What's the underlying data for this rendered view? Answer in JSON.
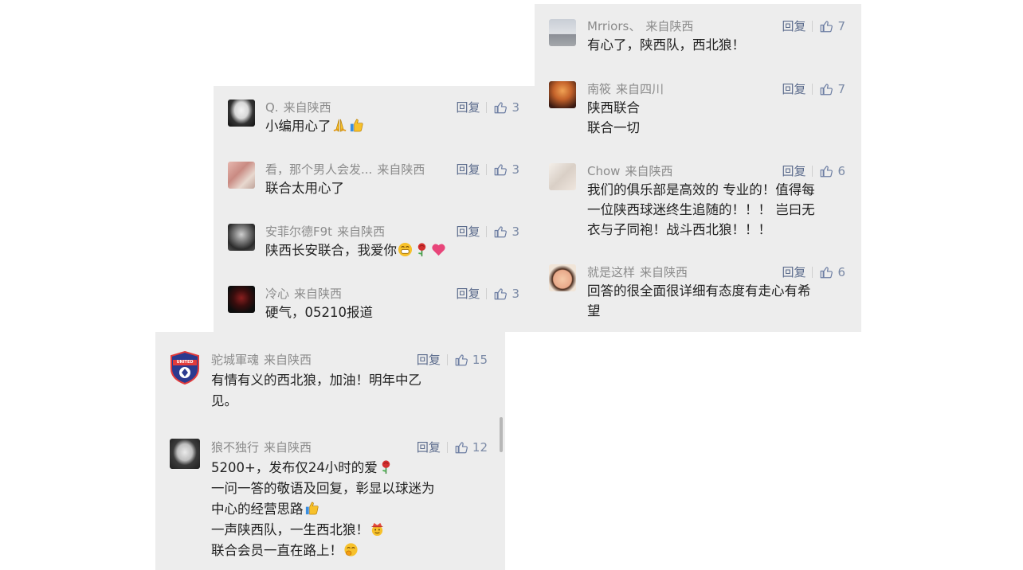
{
  "panel_right": {
    "comments": [
      {
        "name": "Mrriors、",
        "location": "来自陕西",
        "reply": "回复",
        "likes": "7",
        "lines": [
          "有心了，陕西队，西北狼！"
        ]
      },
      {
        "name": "南筱",
        "location": "来自四川",
        "reply": "回复",
        "likes": "7",
        "lines": [
          "陕西联合",
          "联合一切"
        ]
      },
      {
        "name": "Chow",
        "location": "来自陕西",
        "reply": "回复",
        "likes": "6",
        "lines": [
          "我们的俱乐部是高效的 专业的！值得每",
          "一位陕西球迷终生追随的！！！ 岂曰无",
          "衣与子同袍！战斗西北狼！！！"
        ]
      },
      {
        "name": "就是这样",
        "location": "来自陕西",
        "reply": "回复",
        "likes": "6",
        "lines": [
          "回答的很全面很详细有态度有走心有希",
          "望"
        ]
      }
    ]
  },
  "panel_middle": {
    "comments": [
      {
        "name": "Q.",
        "location": "来自陕西",
        "reply": "回复",
        "likes": "3",
        "lines": [
          "小编用心了"
        ]
      },
      {
        "name": "看，那个男人会发...",
        "location": "来自陕西",
        "reply": "回复",
        "likes": "3",
        "lines": [
          "联合太用心了"
        ]
      },
      {
        "name": "安菲尔德F9t",
        "location": "来自陕西",
        "reply": "回复",
        "likes": "3",
        "lines": [
          "陕西长安联合，我爱你"
        ]
      },
      {
        "name": "冷心",
        "location": "来自陕西",
        "reply": "回复",
        "likes": "3",
        "lines": [
          "硬气，05210报道"
        ]
      }
    ]
  },
  "panel_bottom": {
    "comments": [
      {
        "name": "驼城軍魂",
        "location": "来自陕西",
        "reply": "回复",
        "likes": "15",
        "lines": [
          "有情有义的西北狼，加油！明年中乙",
          "见。"
        ]
      },
      {
        "name": "狼不独行",
        "location": "来自陕西",
        "reply": "回复",
        "likes": "12",
        "lines": [
          "5200+，发布仅24小时的爱",
          "一问一答的敬语及回复，彰显以球迷为",
          "中心的经营思路",
          "一声陕西队，一生西北狼！",
          "联合会员一直在路上！"
        ]
      }
    ],
    "badge_text": "UNITED"
  },
  "colors": {
    "panel_bg": "#ededed",
    "meta_text": "#8b8b8b",
    "action_text": "#5b6b8c",
    "body_text": "#222222"
  },
  "icons": [
    "thumb-up-icon",
    "pray-emoji",
    "thumbs-up-emoji",
    "grin-emoji",
    "rose-emoji",
    "heart-emoji",
    "cowboy-emoji",
    "shush-emoji"
  ]
}
